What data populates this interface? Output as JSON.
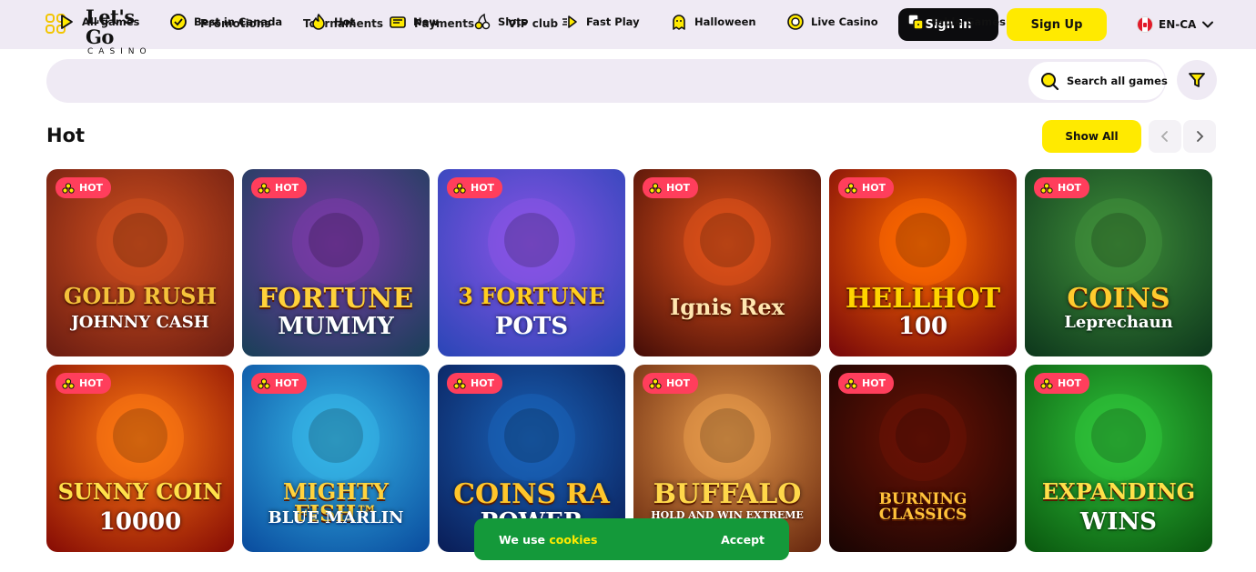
{
  "header": {
    "logo": {
      "line1": "Let's Go",
      "line2": "CASINO"
    },
    "nav": [
      "Promotions",
      "Tournaments",
      "Payments",
      "VIP club"
    ],
    "sign_in": "Sign In",
    "sign_up": "Sign Up",
    "language": "EN-CA"
  },
  "categories": [
    {
      "label": "All games",
      "icon": "play-icon"
    },
    {
      "label": "Best in Canada",
      "icon": "maple-badge-icon"
    },
    {
      "label": "Hot",
      "icon": "flame-icon"
    },
    {
      "label": "New",
      "icon": "new-badge-icon"
    },
    {
      "label": "Slots",
      "icon": "cherries-icon"
    },
    {
      "label": "Fast Play",
      "icon": "fast-forward-icon"
    },
    {
      "label": "Halloween",
      "icon": "ghost-icon"
    },
    {
      "label": "Live Casino",
      "icon": "chip-icon"
    },
    {
      "label": "Table Games",
      "icon": "dice-icon"
    }
  ],
  "search": {
    "label": "Search all games"
  },
  "section": {
    "title": "Hot",
    "show_all": "Show All"
  },
  "badge_label": "HOT",
  "games": [
    {
      "title": "GOLD RUSH",
      "subtitle": "JOHNNY CASH",
      "colors": [
        "#6e1e12",
        "#d2501e"
      ],
      "text_color": "#f5c33b"
    },
    {
      "title": "FORTUNE",
      "subtitle": "MUMMY",
      "colors": [
        "#1c3f5a",
        "#7a3aa8"
      ],
      "text_color": "#ffd23a"
    },
    {
      "title": "3 FORTUNE",
      "subtitle": "POTS",
      "colors": [
        "#2d46b8",
        "#8a54e6"
      ],
      "text_color": "#ffcf1f"
    },
    {
      "title": "Ignis Rex",
      "subtitle": "",
      "colors": [
        "#4a0f08",
        "#e0521a"
      ],
      "text_color": "#ffe6b0"
    },
    {
      "title": "HELLHOT",
      "subtitle": "100",
      "colors": [
        "#7a0a0a",
        "#ff6a00"
      ],
      "text_color": "#ffd400"
    },
    {
      "title": "COINS",
      "subtitle": "Leprechaun",
      "colors": [
        "#0f3a1d",
        "#3f8f3a"
      ],
      "text_color": "#ffcb2e"
    },
    {
      "title": "SUNNY COIN",
      "subtitle": "10000",
      "colors": [
        "#8a0f05",
        "#ff7a12"
      ],
      "text_color": "#ffe14a"
    },
    {
      "title": "MIGHTY FISH™",
      "subtitle": "BLUE MARLIN",
      "colors": [
        "#0b4fa0",
        "#36b7e8"
      ],
      "text_color": "#ffd33d"
    },
    {
      "title": "COINS RA",
      "subtitle": "POWER",
      "colors": [
        "#0a1f5a",
        "#1a63b8"
      ],
      "text_color": "#ffc62b"
    },
    {
      "title": "BUFFALO",
      "subtitle": "HOLD AND WIN EXTREME",
      "colors": [
        "#6a2a10",
        "#e89a4a"
      ],
      "text_color": "#ffd84a"
    },
    {
      "title": "BURNING CLASSICS",
      "subtitle": "",
      "colors": [
        "#1a0503",
        "#6a1205"
      ],
      "text_color": "#ffc23a"
    },
    {
      "title": "EXPANDING",
      "subtitle": "WINS",
      "colors": [
        "#0b5a10",
        "#2fc43a"
      ],
      "text_color": "#ffe04a"
    }
  ],
  "cookie": {
    "text": "We use",
    "link": "cookies",
    "accept": "Accept"
  }
}
